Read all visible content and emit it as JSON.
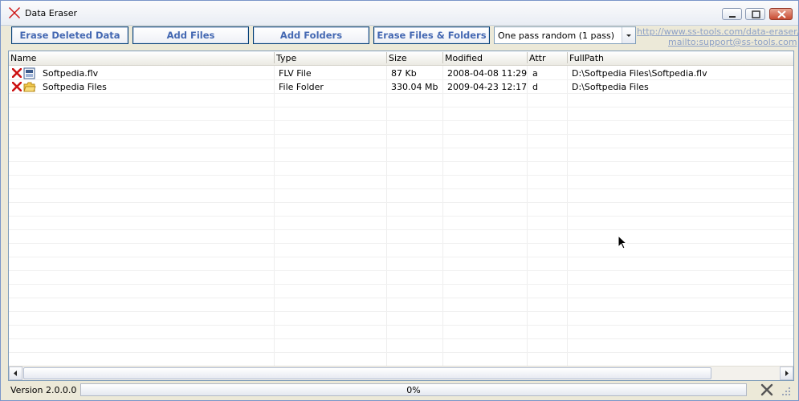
{
  "window": {
    "title": "Data Eraser"
  },
  "toolbar": {
    "erase_deleted": "Erase Deleted Data",
    "add_files": "Add Files",
    "add_folders": "Add Folders",
    "erase_files_folders": "Erase Files & Folders",
    "method_selected": "One pass random (1 pass)",
    "website_link": "http://www.ss-tools.com/data-eraser/",
    "mail_link": "mailto:support@ss-tools.com"
  },
  "list": {
    "columns": [
      "Name",
      "Type",
      "Size",
      "Modified",
      "Attr",
      "FullPath"
    ],
    "rows": [
      {
        "name": "Softpedia.flv",
        "type": "FLV File",
        "size": "87 Kb",
        "modified": "2008-04-08 11:29",
        "attr": "a",
        "fullpath": "D:\\Softpedia Files\\Softpedia.flv",
        "icon": "flv-file-icon"
      },
      {
        "name": "Softpedia Files",
        "type": "File Folder",
        "size": "330.04 Mb",
        "modified": "2009-04-23 12:17",
        "attr": "d",
        "fullpath": "D:\\Softpedia Files",
        "icon": "folder-icon"
      }
    ]
  },
  "status": {
    "version": "Version 2.0.0.0",
    "progress_text": "0%",
    "progress": 0
  },
  "colors": {
    "button_text": "#4468b2",
    "link": "#8ea1c6",
    "delete_red": "#cc1111",
    "accent_border": "#7a96c9"
  }
}
